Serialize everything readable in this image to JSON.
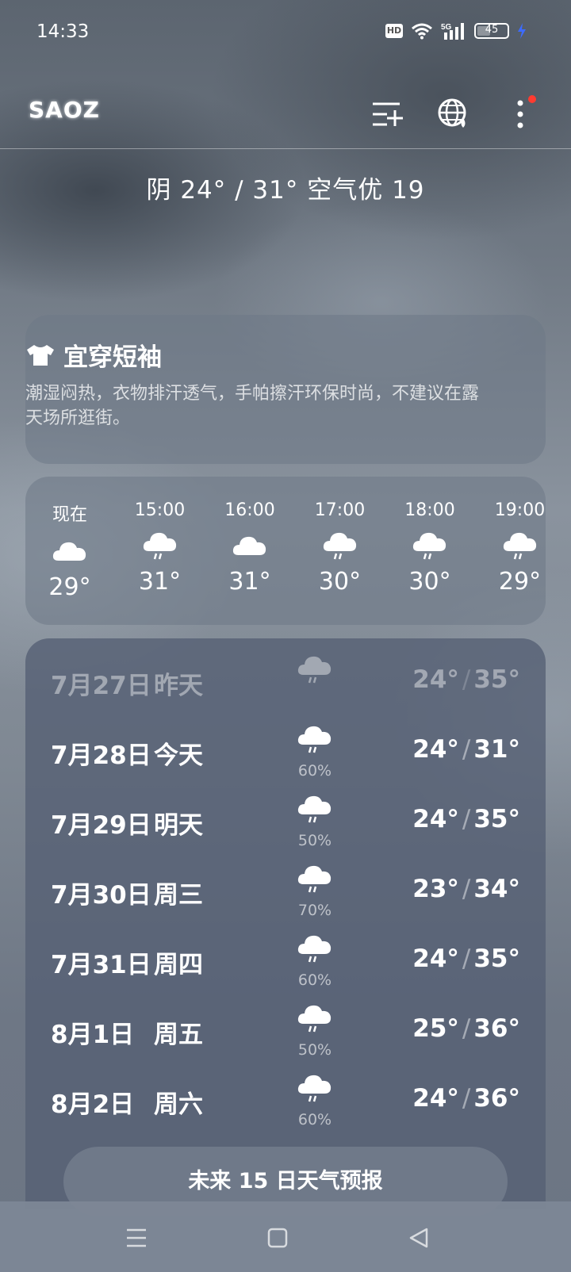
{
  "status_bar": {
    "time": "14:33",
    "hd_label": "HD",
    "network": "5G",
    "battery_level": "45"
  },
  "header": {
    "location": "SAOZ"
  },
  "summary": "阴  24° / 31°  空气优 19",
  "clothing": {
    "title": "宜穿短袖",
    "description": "潮湿闷热，衣物排汗透气，手帕擦汗环保时尚，不建议在露天场所逛街。"
  },
  "hourly": [
    {
      "time": "现在",
      "icon": "cloud-icon",
      "temp": "29°"
    },
    {
      "time": "15:00",
      "icon": "rain-cloud-icon",
      "temp": "31°"
    },
    {
      "time": "16:00",
      "icon": "cloud-icon",
      "temp": "31°"
    },
    {
      "time": "17:00",
      "icon": "rain-cloud-icon",
      "temp": "30°"
    },
    {
      "time": "18:00",
      "icon": "rain-cloud-icon",
      "temp": "30°"
    },
    {
      "time": "19:00",
      "icon": "rain-cloud-icon",
      "temp": "29°"
    }
  ],
  "daily": [
    {
      "date": "7月27日",
      "day": "昨天",
      "precip": "",
      "low": "24°",
      "high": "35°",
      "icon": "rain-cloud-icon"
    },
    {
      "date": "7月28日",
      "day": "今天",
      "precip": "60%",
      "low": "24°",
      "high": "31°",
      "icon": "rain-cloud-icon"
    },
    {
      "date": "7月29日",
      "day": "明天",
      "precip": "50%",
      "low": "24°",
      "high": "35°",
      "icon": "rain-cloud-icon"
    },
    {
      "date": "7月30日",
      "day": "周三",
      "precip": "70%",
      "low": "23°",
      "high": "34°",
      "icon": "rain-cloud-icon"
    },
    {
      "date": "7月31日",
      "day": "周四",
      "precip": "60%",
      "low": "24°",
      "high": "35°",
      "icon": "rain-cloud-icon"
    },
    {
      "date": "8月1日",
      "day": "周五",
      "precip": "50%",
      "low": "25°",
      "high": "36°",
      "icon": "rain-cloud-icon"
    },
    {
      "date": "8月2日",
      "day": "周六",
      "precip": "60%",
      "low": "24°",
      "high": "36°",
      "icon": "rain-cloud-icon"
    }
  ],
  "forecast_button": "未来 15 日天气预报",
  "icons": {
    "add_city": "add-city-icon",
    "globe": "globe-icon",
    "more": "more-vertical-icon",
    "clothing": "tshirt-icon"
  },
  "colors": {
    "notification_dot": "#ff3b30"
  }
}
